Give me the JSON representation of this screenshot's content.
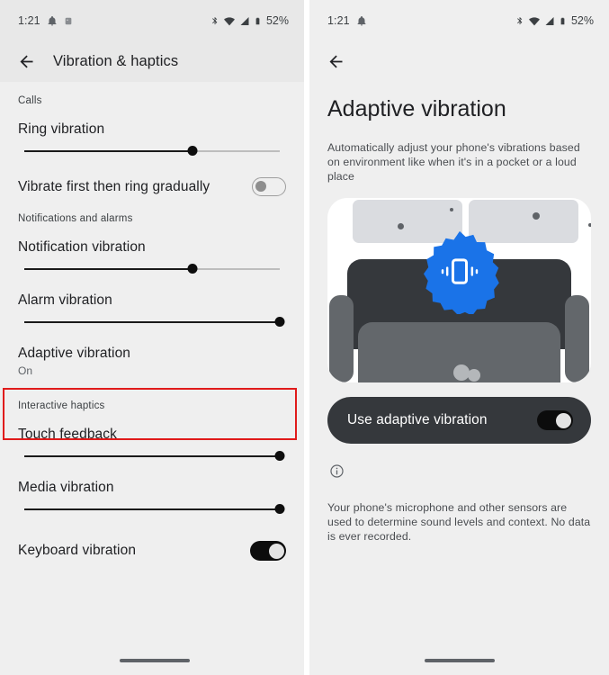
{
  "left": {
    "status_bar": {
      "time": "1:21",
      "notification_icons": [
        "bell-icon",
        "app-notification-icon"
      ],
      "system_icons": [
        "bluetooth-icon",
        "wifi-icon",
        "cellular-signal-icon",
        "battery-icon"
      ],
      "battery_percent": "52%"
    },
    "app_bar": {
      "back_label": "back-arrow",
      "title": "Vibration & haptics"
    },
    "sections": [
      {
        "header": "Calls",
        "items": [
          {
            "type": "slider",
            "title": "Ring vibration",
            "value": 66
          },
          {
            "type": "switch",
            "title": "Vibrate first then ring gradually",
            "state": "off"
          }
        ]
      },
      {
        "header": "Notifications and alarms",
        "items": [
          {
            "type": "slider",
            "title": "Notification vibration",
            "value": 66
          },
          {
            "type": "slider",
            "title": "Alarm vibration",
            "value": 100
          },
          {
            "type": "nav",
            "title": "Adaptive vibration",
            "subtitle": "On",
            "highlighted": true
          }
        ]
      },
      {
        "header": "Interactive haptics",
        "items": [
          {
            "type": "slider",
            "title": "Touch feedback",
            "value": 100
          },
          {
            "type": "slider",
            "title": "Media vibration",
            "value": 100
          },
          {
            "type": "switch",
            "title": "Keyboard vibration",
            "state": "on"
          }
        ]
      }
    ],
    "highlight_color": "#e01b1b"
  },
  "right": {
    "status_bar": {
      "time": "1:21",
      "notification_icons": [
        "bell-icon"
      ],
      "system_icons": [
        "bluetooth-icon",
        "wifi-icon",
        "cellular-signal-icon",
        "battery-icon"
      ],
      "battery_percent": "52%"
    },
    "app_bar": {
      "back_label": "back-arrow"
    },
    "title": "Adaptive vibration",
    "description": "Automatically adjust your phone's vibrations based on environment like when it's in a pocket or a loud place",
    "illustration": {
      "name": "couch-with-vibrating-phone-badge",
      "badge_color": "#1a73e8",
      "badge_icon": "phone-vibrate-icon",
      "couch_back_color": "#35383c",
      "couch_body_color": "#63676b",
      "frame_color": "#dadce0"
    },
    "toggle_card": {
      "label": "Use adaptive vibration",
      "state": "on"
    },
    "info_icon": "info-circle-icon",
    "footer_note": "Your phone's microphone and other sensors are used to determine sound levels and context. No data is ever recorded."
  }
}
